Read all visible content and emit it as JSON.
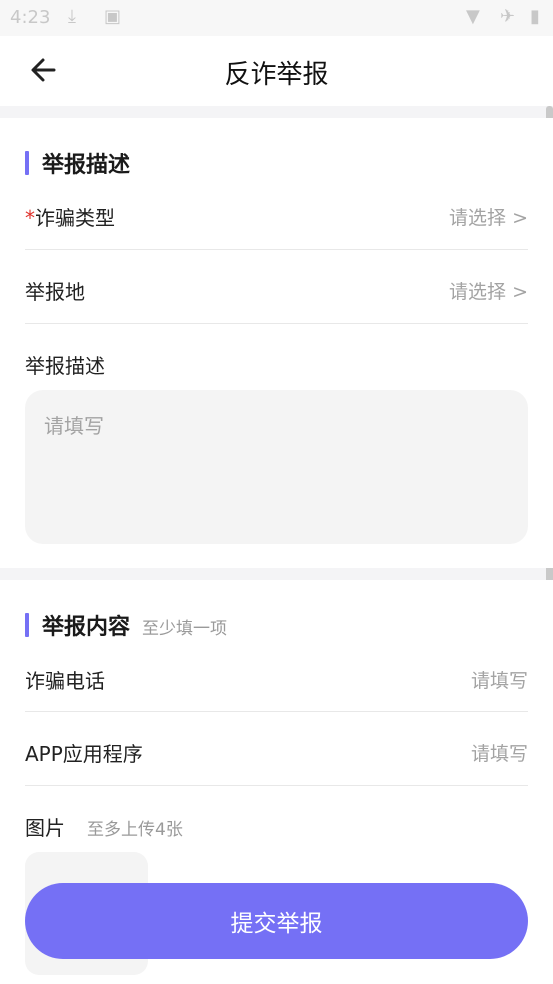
{
  "status_bar": {
    "time": "4:23"
  },
  "header": {
    "title": "反诈举报"
  },
  "section_description": {
    "title": "举报描述",
    "fraud_type": {
      "required_mark": "*",
      "label": "诈骗类型",
      "value": "请选择 >"
    },
    "report_location": {
      "label": "举报地",
      "value": "请选择 >"
    },
    "description": {
      "label": "举报描述",
      "placeholder": "请填写"
    }
  },
  "section_content": {
    "title": "举报内容",
    "hint": "至少填一项",
    "fraud_phone": {
      "label": "诈骗电话",
      "placeholder": "请填写"
    },
    "app_program": {
      "label": "APP应用程序",
      "placeholder": "请填写"
    },
    "images": {
      "label": "图片",
      "hint": "至多上传4张"
    }
  },
  "submit_label": "提交举报",
  "colors": {
    "accent": "#7570f5",
    "required": "#e0322c",
    "placeholder": "#a3a3a3"
  }
}
